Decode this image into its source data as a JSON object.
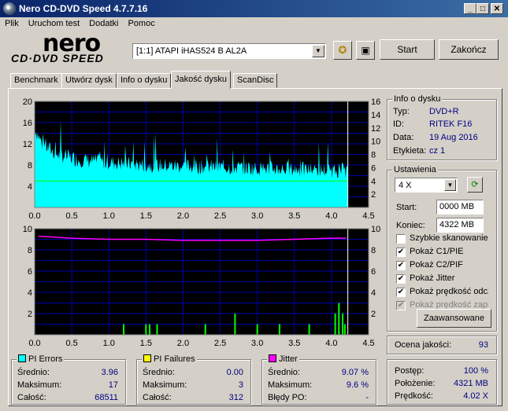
{
  "window": {
    "title": "Nero CD-DVD Speed 4.7.7.16",
    "min": "_",
    "max": "□",
    "close": "✕"
  },
  "menu": [
    "Plik",
    "Uruchom test",
    "Dodatki",
    "Pomoc"
  ],
  "logo": {
    "line1": "nero",
    "line2": "CD·DVD SPEED"
  },
  "toolbar": {
    "drive": "[1:1]   ATAPI iHAS524   B AL2A",
    "start": "Start",
    "exit": "Zakończ"
  },
  "tabs": [
    "Benchmark",
    "Utwórz dysk",
    "Info o dysku",
    "Jakość dysku",
    "ScanDisc"
  ],
  "disc_info": {
    "title": "Info o dysku",
    "type_label": "Typ:",
    "type": "DVD+R",
    "id_label": "ID:",
    "id": "RITEK F16",
    "date_label": "Data:",
    "date": "19 Aug 2016",
    "label_label": "Etykieta:",
    "label": "cz 1"
  },
  "settings": {
    "title": "Ustawienia",
    "speed": "4 X",
    "start_label": "Start:",
    "start": "0000 MB",
    "end_label": "Koniec:",
    "end": "4322 MB",
    "checkboxes": [
      {
        "label": "Szybkie skanowanie",
        "checked": false,
        "disabled": false
      },
      {
        "label": "Pokaż C1/PIE",
        "checked": true,
        "disabled": false
      },
      {
        "label": "Pokaż C2/PIF",
        "checked": true,
        "disabled": false
      },
      {
        "label": "Pokaż Jitter",
        "checked": true,
        "disabled": false
      },
      {
        "label": "Pokaż prędkość odczytu",
        "checked": true,
        "disabled": false
      },
      {
        "label": "Pokaż prędkość zapisu",
        "checked": true,
        "disabled": true
      }
    ],
    "advanced": "Zaawansowane"
  },
  "quality": {
    "label": "Ocena jakości:",
    "value": "93"
  },
  "pi_errors": {
    "title": "PI Errors",
    "avg_label": "Średnio:",
    "avg": "3.96",
    "max_label": "Maksimum:",
    "max": "17",
    "total_label": "Całość:",
    "total": "68511"
  },
  "pi_failures": {
    "title": "PI Failures",
    "avg_label": "Średnio:",
    "avg": "0.00",
    "max_label": "Maksimum:",
    "max": "3",
    "total_label": "Całość:",
    "total": "312"
  },
  "jitter": {
    "title": "Jitter",
    "avg_label": "Średnio:",
    "avg": "9.07 %",
    "max_label": "Maksimum:",
    "max": "9.6 %",
    "po_label": "Błędy PO:",
    "po": "-"
  },
  "progress": {
    "progress_label": "Postęp:",
    "progress": "100 %",
    "position_label": "Położenie:",
    "position": "4321 MB",
    "speed_label": "Prędkość:",
    "speed": "4.02 X"
  },
  "colors": {
    "pie": "#00ffff",
    "pif": "#00ff00",
    "jitter": "#ff00ff",
    "speed": "#00ff00",
    "grid": "#0000aa",
    "chartbg": "#000000"
  },
  "chart_data": [
    {
      "type": "area",
      "x_ticks": [
        "0.0",
        "0.5",
        "1.0",
        "1.5",
        "2.0",
        "2.5",
        "3.0",
        "3.5",
        "4.0",
        "4.5"
      ],
      "y_left_ticks": [
        "20",
        "16",
        "12",
        "8",
        "4"
      ],
      "y_right_ticks": [
        "16",
        "14",
        "12",
        "10",
        "8",
        "6",
        "4",
        "2"
      ],
      "xlim": [
        0,
        4.5
      ],
      "ylim_left": [
        0,
        20
      ],
      "ylim_right": [
        0,
        16
      ],
      "pie_profile": [
        [
          0,
          15
        ],
        [
          0.1,
          12
        ],
        [
          0.3,
          10
        ],
        [
          0.6,
          9
        ],
        [
          1.0,
          8.5
        ],
        [
          1.5,
          8
        ],
        [
          2.0,
          7.8
        ],
        [
          2.5,
          7.6
        ],
        [
          3.0,
          7.4
        ],
        [
          3.5,
          7.2
        ],
        [
          4.0,
          7
        ],
        [
          4.22,
          7
        ]
      ],
      "read_speed_x": 4.0,
      "end_x": 4.22
    },
    {
      "type": "bar",
      "x_ticks": [
        "0.0",
        "0.5",
        "1.0",
        "1.5",
        "2.0",
        "2.5",
        "3.0",
        "3.5",
        "4.0",
        "4.5"
      ],
      "y_left_ticks": [
        "10",
        "8",
        "6",
        "4",
        "2"
      ],
      "y_right_ticks": [
        "10",
        "8",
        "6",
        "4",
        "2"
      ],
      "xlim": [
        0,
        4.5
      ],
      "ylim_left": [
        0,
        10
      ],
      "ylim_right": [
        0,
        10
      ],
      "pif_bars": [
        [
          1.2,
          1
        ],
        [
          1.5,
          1
        ],
        [
          1.55,
          1
        ],
        [
          1.65,
          1
        ],
        [
          2.3,
          1
        ],
        [
          2.7,
          2
        ],
        [
          3.0,
          1
        ],
        [
          3.3,
          1
        ],
        [
          3.7,
          1
        ],
        [
          4.05,
          2
        ],
        [
          4.1,
          3
        ],
        [
          4.15,
          2
        ],
        [
          4.18,
          1
        ]
      ],
      "jitter_line": [
        [
          0.05,
          9.3
        ],
        [
          0.5,
          9.1
        ],
        [
          1.0,
          9.0
        ],
        [
          1.5,
          9.0
        ],
        [
          2.0,
          8.9
        ],
        [
          2.5,
          8.9
        ],
        [
          3.0,
          8.9
        ],
        [
          3.5,
          9.0
        ],
        [
          4.0,
          9.1
        ],
        [
          4.2,
          9.1
        ]
      ],
      "end_x": 4.22
    }
  ]
}
